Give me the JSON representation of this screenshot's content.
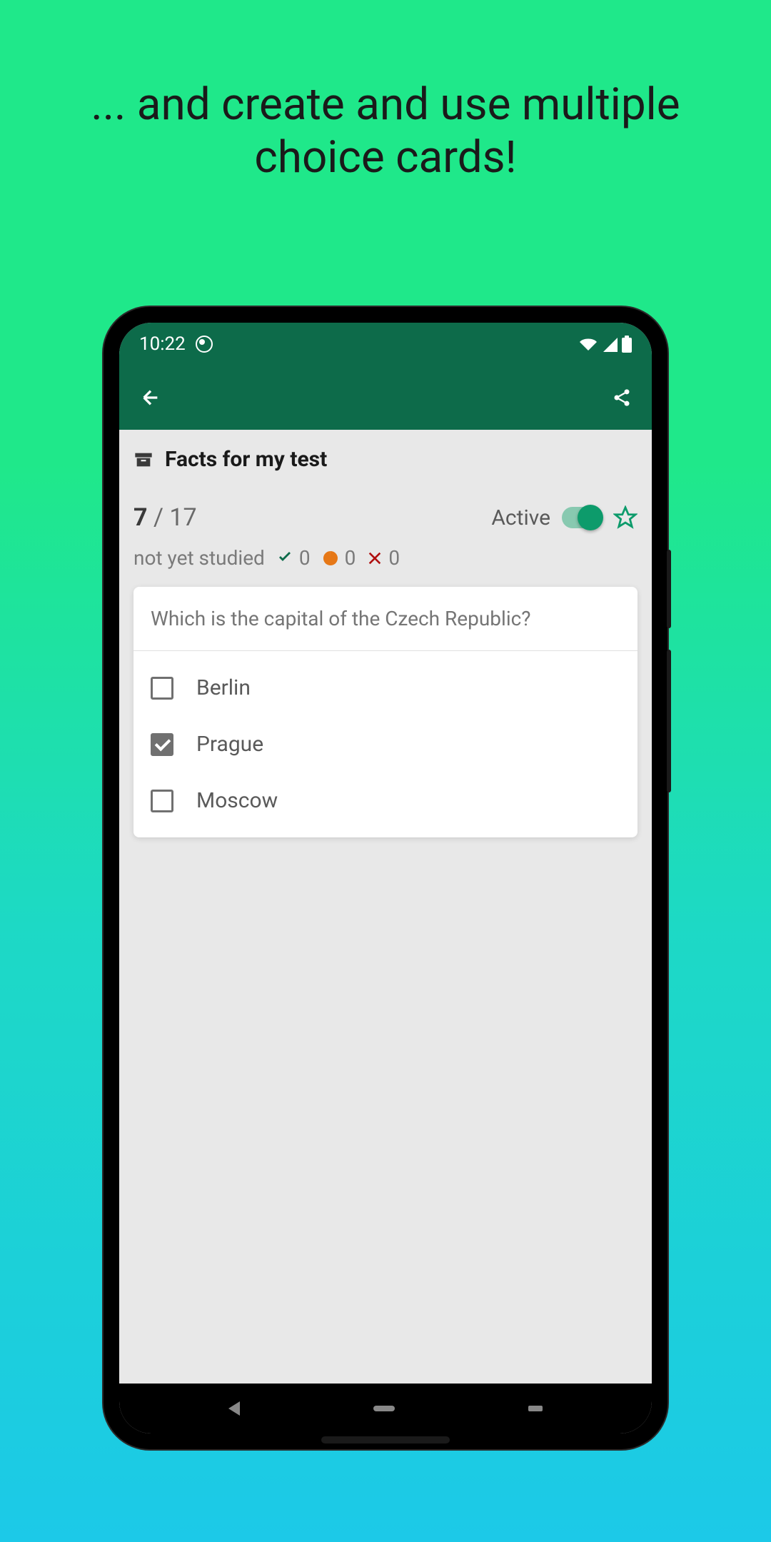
{
  "promo": {
    "text": "... and create and use multiple choice cards!"
  },
  "statusBar": {
    "time": "10:22"
  },
  "deck": {
    "title": "Facts for my test"
  },
  "counter": {
    "current": "7",
    "separator": " / ",
    "total": "17"
  },
  "active": {
    "label": "Active"
  },
  "studyStatus": {
    "label": "not yet studied",
    "correct": "0",
    "partial": "0",
    "wrong": "0"
  },
  "card": {
    "question": "Which is the capital of the Czech Republic?",
    "options": [
      {
        "label": "Berlin",
        "checked": false
      },
      {
        "label": "Prague",
        "checked": true
      },
      {
        "label": "Moscow",
        "checked": false
      }
    ]
  }
}
